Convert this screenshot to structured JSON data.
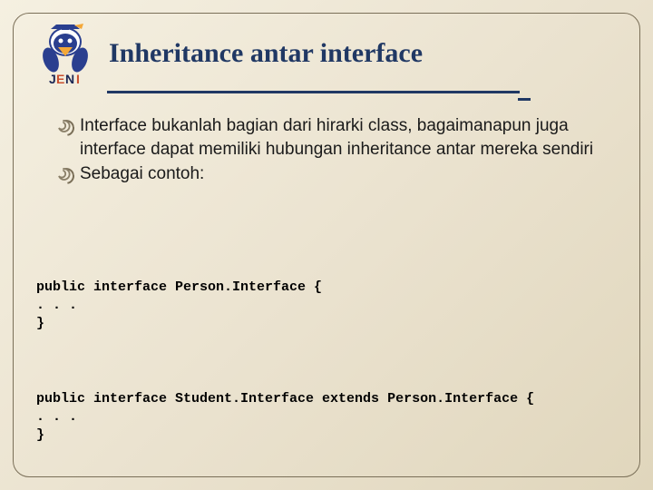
{
  "logo_name": "jeni-logo",
  "title": "Inheritance antar interface",
  "bullets": [
    "Interface bukanlah bagian dari hirarki class, bagaimanapun juga interface dapat memiliki hubungan inheritance antar mereka sendiri",
    "Sebagai contoh:"
  ],
  "code": [
    "public interface Person.Interface {\n. . .\n}",
    "public interface Student.Interface extends Person.Interface {\n. . .\n}"
  ]
}
